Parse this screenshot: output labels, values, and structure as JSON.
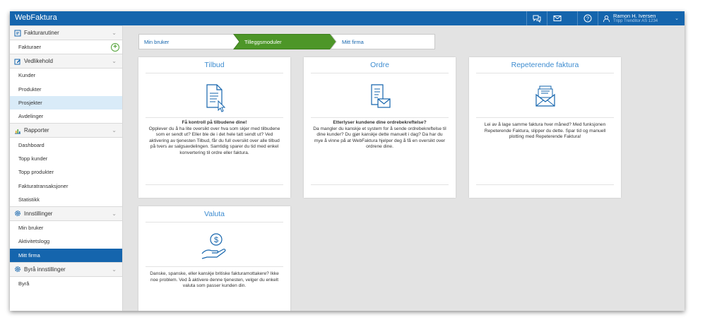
{
  "app": {
    "title": "WebFaktura"
  },
  "topbar": {
    "user_name": "Ramon H. Iversen",
    "user_sub": "Tripp Trenditor AS 1234"
  },
  "sidebar": {
    "sections": [
      {
        "label": "Fakturarutiner",
        "icon": "invoice-icon",
        "items": [
          "Fakturaer"
        ]
      },
      {
        "label": "Vedlikehold",
        "icon": "edit-icon",
        "items": [
          "Kunder",
          "Produkter",
          "Prosjekter",
          "Avdelinger"
        ]
      },
      {
        "label": "Rapporter",
        "icon": "bar-chart-icon",
        "items": [
          "Dashboard",
          "Topp kunder",
          "Topp produkter",
          "Fakturatransaksjoner",
          "Statistikk"
        ]
      },
      {
        "label": "Innstillinger",
        "icon": "gear-icon",
        "items": [
          "Min bruker",
          "Aktivitetslogg",
          "Mitt firma"
        ]
      },
      {
        "label": "Byrå innstillinger",
        "icon": "gear-icon",
        "items": [
          "Byrå"
        ]
      }
    ],
    "highlighted_item": "Prosjekter",
    "active_item": "Mitt firma"
  },
  "wizard": {
    "steps": [
      "Min bruker",
      "Tilleggsmoduler",
      "Mitt firma"
    ],
    "active_step": "Tilleggsmoduler"
  },
  "cards": [
    {
      "title": "Tilbud",
      "icon": "document-cursor-icon",
      "heading": "Få kontroll på tilbudene dine!",
      "body": "Opplever du å ha lite oversikt over hva som skjer med tilbudene som er sendt ut? Eller ble de i det hele tatt sendt ut? Ved aktivering av tjenesten Tilbud, får du full oversikt over alle tilbud på tvers av salgsavdelingen. Samtidig sparer du tid med enkel konvertering til ordre eller faktura."
    },
    {
      "title": "Ordre",
      "icon": "order-envelope-icon",
      "heading": "Etterlyser kundene dine ordrebekreftelse?",
      "body": "Da mangler du kanskje et system for å sende ordrebekreftelse til dine kunder? Du gjør kanskje dette manuelt i dag? Da har du mye å vinne på at WebFaktura hjelper deg å få en oversikt over ordrene dine."
    },
    {
      "title": "Repeterende faktura",
      "icon": "envelope-stack-icon",
      "heading": "",
      "body": "Lei av å lage samme faktura hver måned? Med funksjonen Repeterende Faktura, slipper du dette. Spar tid og manuell plotting med Repeterende Faktura!"
    },
    {
      "title": "Valuta",
      "icon": "coin-hand-icon",
      "heading": "",
      "body": "Danske, spanske, eller kanskje britiske fakturamottakere? Ikke noe problem. Ved å aktivere denne tjenesten, velger du enkelt valuta som passer kunden din."
    }
  ],
  "colors": {
    "primary": "#1565ad",
    "accent_green": "#52a238",
    "title_blue": "#3d8cd0"
  }
}
